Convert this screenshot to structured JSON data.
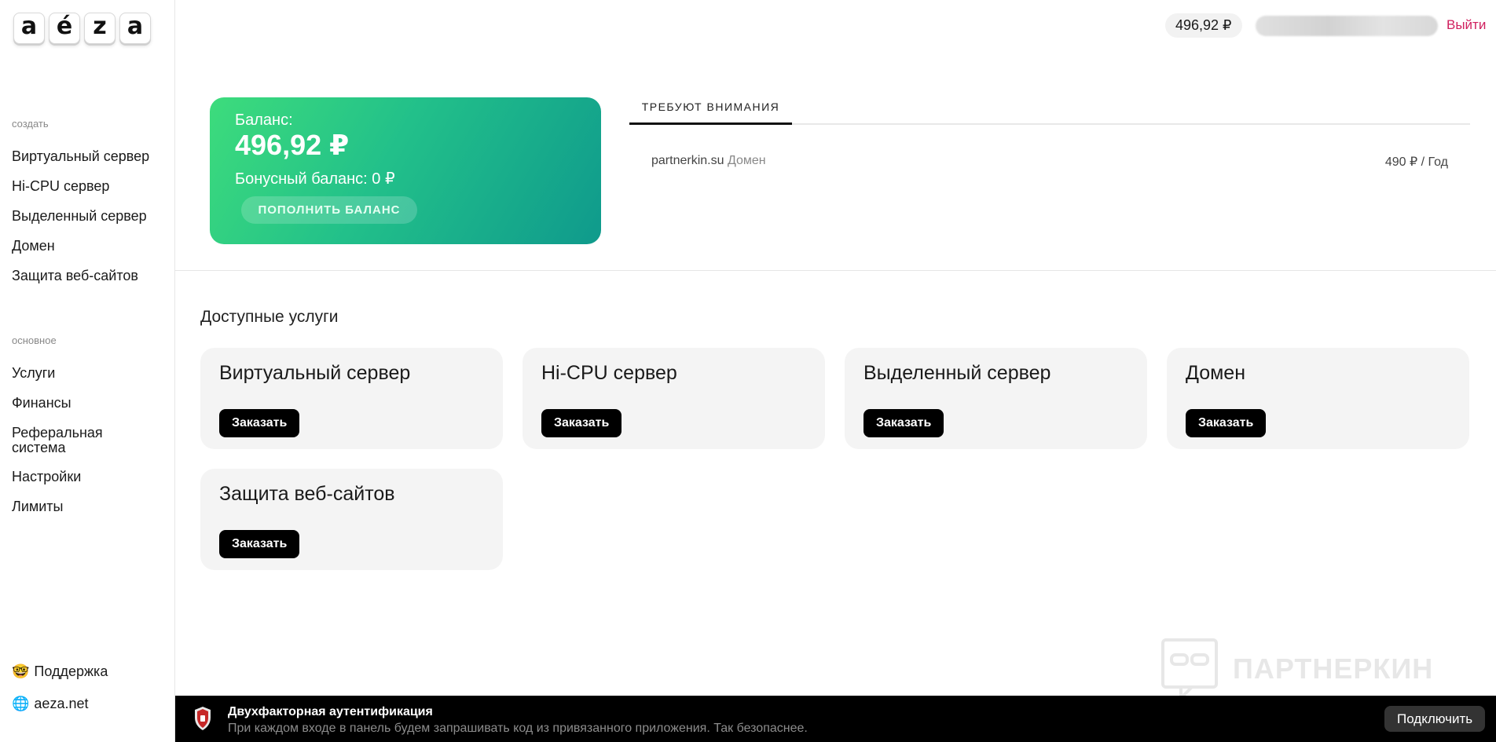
{
  "logo": {
    "letters": [
      "a",
      "é",
      "z",
      "a"
    ]
  },
  "sidebar": {
    "create_label": "создать",
    "create_items": [
      {
        "label": "Виртуальный сервер"
      },
      {
        "label": "Hi-CPU сервер"
      },
      {
        "label": "Выделенный сервер"
      },
      {
        "label": "Домен"
      },
      {
        "label": "Защита веб-сайтов"
      }
    ],
    "main_label": "основное",
    "main_items": [
      {
        "label": "Услуги"
      },
      {
        "label": "Финансы"
      },
      {
        "label": "Реферальная система"
      },
      {
        "label": "Настройки"
      },
      {
        "label": "Лимиты"
      }
    ],
    "support": {
      "emoji": "🤓",
      "label": "Поддержка"
    },
    "site": {
      "emoji": "🌐",
      "label": "aeza.net"
    }
  },
  "header": {
    "balance": "496,92 ₽",
    "logout": "Выйти"
  },
  "balance_card": {
    "label": "Баланс:",
    "value": "496,92 ₽",
    "bonus": "Бонусный баланс: 0 ₽",
    "topup_button": "ПОПОЛНИТЬ БАЛАНС"
  },
  "attention": {
    "tab_label": "ТРЕБУЮТ ВНИМАНИЯ",
    "items": [
      {
        "name": "partnerkin.su",
        "type": "Домен",
        "price": "490 ₽ / Год"
      }
    ]
  },
  "services": {
    "title": "Доступные услуги",
    "order_label": "Заказать",
    "cards": [
      {
        "title": "Виртуальный сервер"
      },
      {
        "title": "Hi-CPU сервер"
      },
      {
        "title": "Выделенный сервер"
      },
      {
        "title": "Домен"
      },
      {
        "title": "Защита веб-сайтов"
      }
    ]
  },
  "watermark": {
    "text": "ПАРТНЕРКИН"
  },
  "twofa": {
    "title": "Двухфакторная аутентификация",
    "description": "При каждом входе в панель будем запрашивать код из привязанного приложения. Так безопаснее.",
    "button": "Подключить"
  }
}
